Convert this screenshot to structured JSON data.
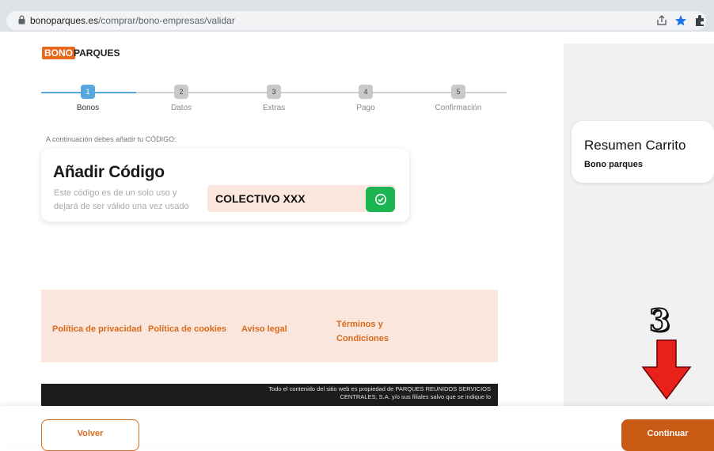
{
  "browser": {
    "url_domain": "bonoparques.es",
    "url_path": "/comprar/bono-empresas/validar",
    "icons": [
      "lock-icon",
      "share-icon",
      "star-icon",
      "extensions-icon"
    ]
  },
  "logo": {
    "part1": "BONO",
    "part2": "PARQUES"
  },
  "steps": [
    {
      "num": "1",
      "label": "Bonos"
    },
    {
      "num": "2",
      "label": "Datos"
    },
    {
      "num": "3",
      "label": "Extras"
    },
    {
      "num": "4",
      "label": "Pago"
    },
    {
      "num": "5",
      "label": "Confirmación"
    }
  ],
  "intro": "A continuación debes añadir tu CÓDIGO:",
  "code_card": {
    "title": "Añadir Código",
    "description": "Este código es de un solo uso y dejará de ser válido una vez usado",
    "value": "COLECTIVO XXX"
  },
  "footer_links": [
    "Política de privacidad",
    "Política de cookies",
    "Aviso legal",
    "Términos y Condiciones"
  ],
  "legal_text": "Todo el contenido del sitio web es propiedad de PARQUES REUNIDOS SERVICIOS CENTRALES, S.A. y/o sus filiales salvo que se indique lo",
  "cart": {
    "title": "Resumen Carrito",
    "subtitle": "Bono parques"
  },
  "buttons": {
    "back": "Volver",
    "continue": "Continuar"
  },
  "annotation": {
    "number": "3"
  },
  "colors": {
    "brand": "#e9661b",
    "active_step": "#55a8dd",
    "ok_green": "#1db552",
    "arrow_red": "#e8221b"
  }
}
